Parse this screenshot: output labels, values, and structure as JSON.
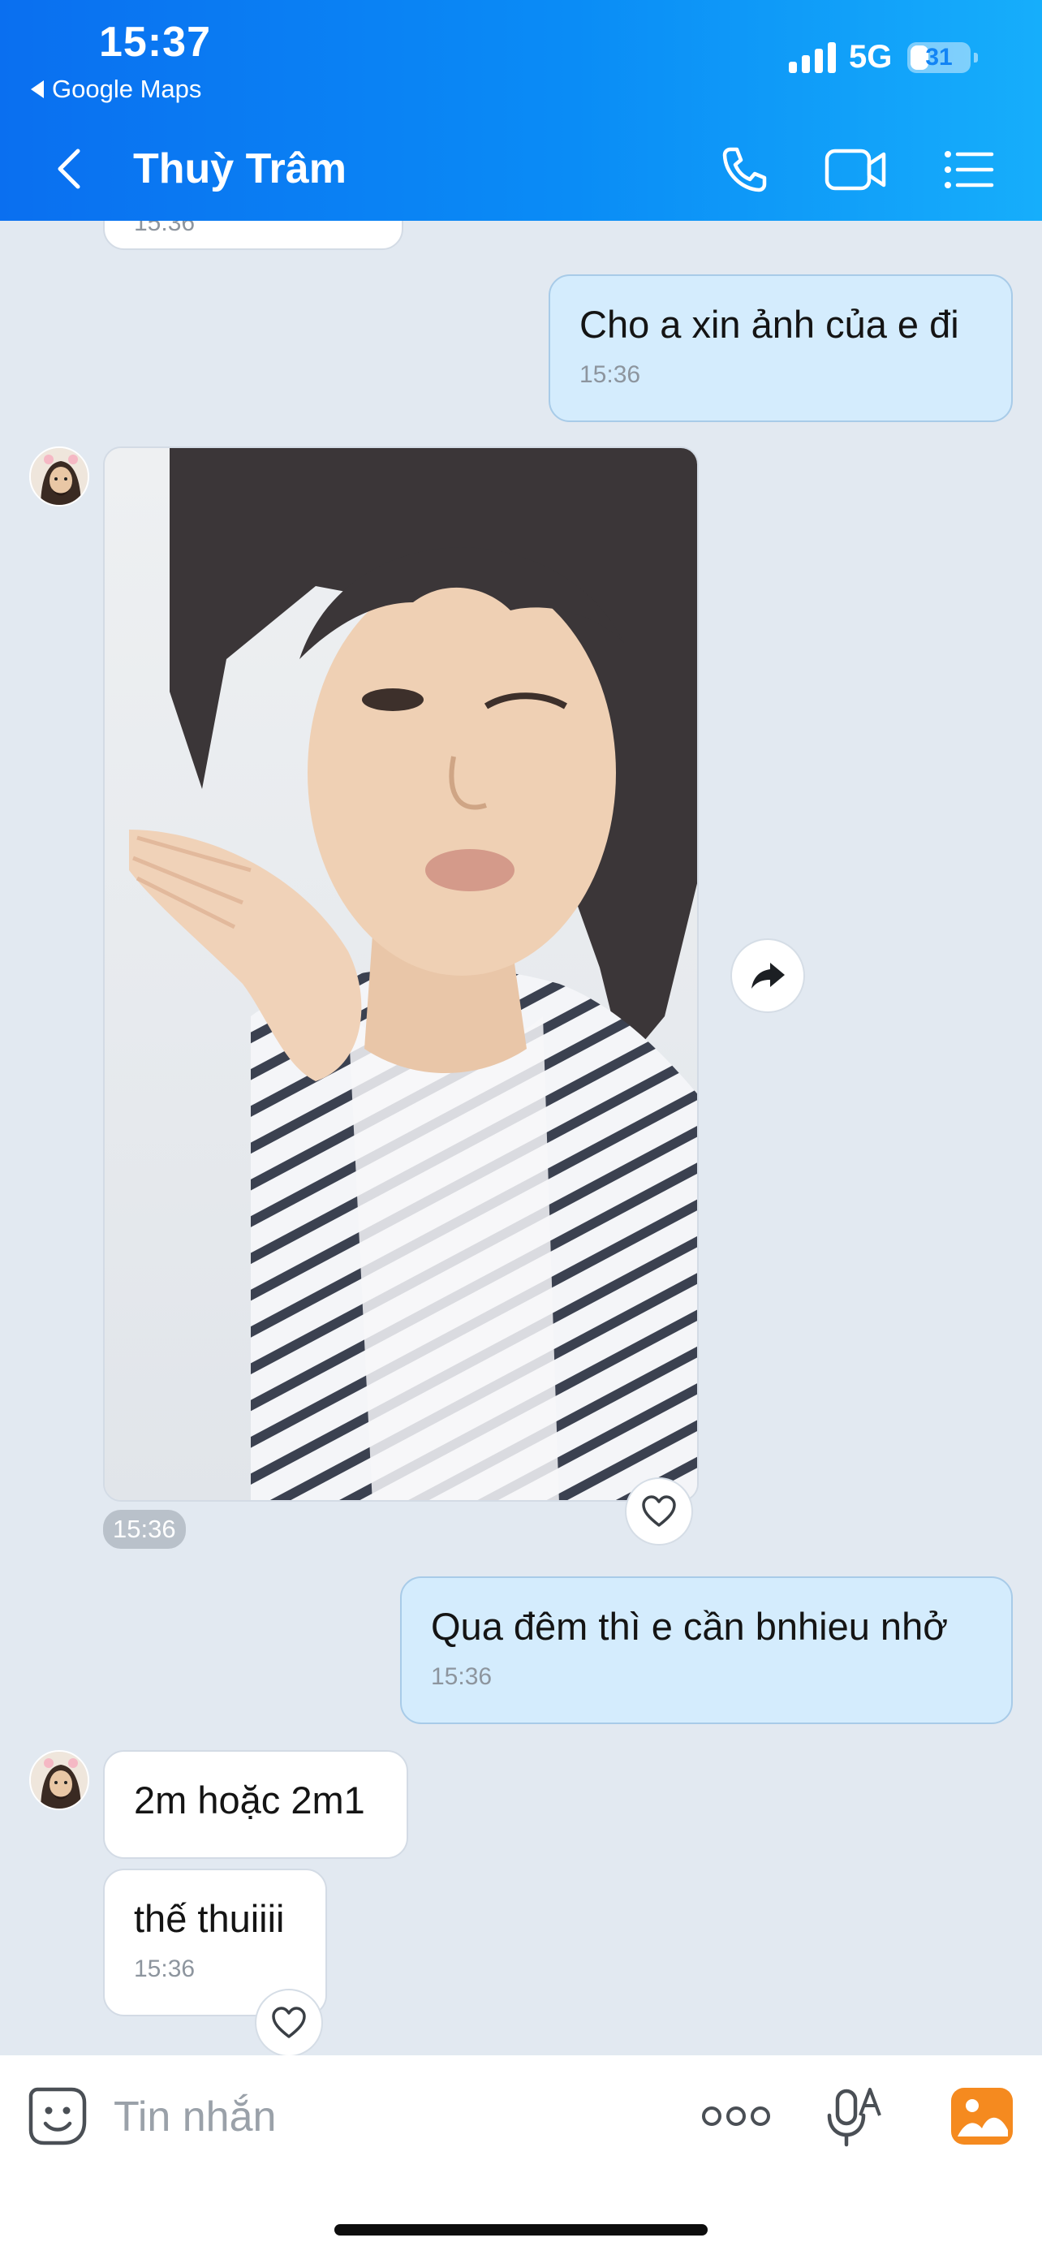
{
  "status_bar": {
    "time": "15:37",
    "back_app": "Google Maps",
    "network": "5G",
    "battery": "31",
    "battery_level": 0.31
  },
  "header": {
    "title": "Thuỳ Trâm",
    "icons": [
      "back-arrow-icon",
      "phone-icon",
      "video-call-icon",
      "menu-list-icon"
    ]
  },
  "messages": {
    "top_partial_time": "15:36",
    "m1": {
      "text": "Cho a xin ảnh của e đi",
      "time": "15:36"
    },
    "photo": {
      "time": "15:36",
      "reaction_icon": "heart-outline-icon",
      "share_icon": "share-forward-icon"
    },
    "m2": {
      "text": "Qua đêm thì e cần bnhieu nhở",
      "time": "15:36"
    },
    "m3": {
      "text": "2m hoặc 2m1"
    },
    "m4": {
      "text": "thế thuiiii",
      "time": "15:36",
      "reaction_icon": "heart-outline-icon"
    }
  },
  "composer": {
    "placeholder": "Tin nhắn",
    "icons": [
      "emoji-sticker-icon",
      "more-dots-icon",
      "voice-to-text-icon",
      "photo-gallery-icon"
    ]
  },
  "colors": {
    "header_start": "#0a6ff0",
    "header_end": "#16aefb",
    "chat_bg": "#e2e9f1",
    "sent_bubble": "#d4ecfd",
    "received_bubble": "#ffffff",
    "photo_icon": "#f58a1f"
  }
}
